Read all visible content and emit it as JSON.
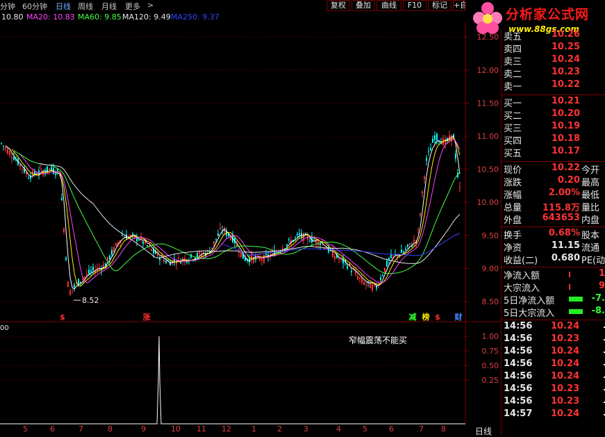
{
  "tabs": [
    {
      "label": "分钟",
      "active": false
    },
    {
      "label": "60分钟",
      "active": false
    },
    {
      "label": "日线",
      "active": true
    },
    {
      "label": "周线",
      "active": false
    },
    {
      "label": "月线",
      "active": false
    },
    {
      "label": "更多",
      "active": false
    }
  ],
  "more_arrow": ">",
  "toolbar": {
    "fuquan": "复权",
    "diejia": "叠加",
    "quxian": "曲线",
    "f10": "F10",
    "biaoji": "标记",
    "plus": "+自"
  },
  "ma_bar": [
    {
      "text": "10.80",
      "color": "#e8e8e8"
    },
    {
      "text": "MA20: 10.83",
      "color": "#ff44ff"
    },
    {
      "text": "MA60: 9.85",
      "color": "#44ff44"
    },
    {
      "text": "MA120: 9.49",
      "color": "#e8e8e8"
    },
    {
      "text": "MA250: 9.37",
      "color": "#3344ff"
    }
  ],
  "logo": {
    "title": "分析家公式网",
    "url": "www.88gs.com"
  },
  "price_axis": [
    "12.50",
    "12.00",
    "11.50",
    "11.00",
    "10.50",
    "10.00",
    "9.50",
    "9.00",
    "8.50"
  ],
  "low_label": "8.52",
  "markers": [
    {
      "text": "$",
      "color": "#ff3030"
    },
    {
      "text": "涨",
      "color": "#ff3030"
    },
    {
      "text": "减",
      "color": "#33ff33"
    },
    {
      "text": "榜",
      "color": "#ffee00"
    },
    {
      "text": "$",
      "color": "#ff3030"
    },
    {
      "text": "财",
      "color": "#4488ff"
    }
  ],
  "indicator": {
    "label_left": "00",
    "note": "窄幅震荡不能买",
    "axis": [
      "1.00",
      "0.75",
      "0.50",
      "0.25"
    ]
  },
  "x_axis": [
    "5",
    "6",
    "7",
    "8",
    "9",
    "10",
    "11",
    "12",
    "1",
    "2",
    "3",
    "4",
    "5",
    "6",
    "7",
    "8"
  ],
  "bottom_tab": "日线",
  "quote": {
    "sell": [
      {
        "label": "卖五",
        "value": "10.26"
      },
      {
        "label": "卖四",
        "value": "10.25"
      },
      {
        "label": "卖三",
        "value": "10.24"
      },
      {
        "label": "卖二",
        "value": "10.23"
      },
      {
        "label": "卖一",
        "value": "10.22"
      }
    ],
    "buy": [
      {
        "label": "买一",
        "value": "10.21"
      },
      {
        "label": "买二",
        "value": "10.20"
      },
      {
        "label": "买三",
        "value": "10.19"
      },
      {
        "label": "买四",
        "value": "10.18"
      },
      {
        "label": "买五",
        "value": "10.17"
      }
    ],
    "stats": [
      {
        "label": "现价",
        "value": "10.22",
        "label2": "今开"
      },
      {
        "label": "涨跌",
        "value": "0.20",
        "label2": "最高"
      },
      {
        "label": "涨幅",
        "value": "2.00%",
        "label2": "最低"
      },
      {
        "label": "总量",
        "value": "115.8万",
        "label2": "量比"
      },
      {
        "label": "外盘",
        "value": "643653",
        "label2": "内盘"
      }
    ],
    "stats2": [
      {
        "label": "换手",
        "value": "0.68%",
        "label2": "股本"
      },
      {
        "label": "净资",
        "value": "11.15",
        "label2": "流通"
      },
      {
        "label": "收益(二)",
        "value": "0.680",
        "label2": "PE(动"
      }
    ],
    "flow": [
      {
        "label": "净流入额",
        "value": "1"
      },
      {
        "label": "大宗流入",
        "value": "9"
      },
      {
        "label": "5日净流入额",
        "value": "-7."
      },
      {
        "label": "5日大宗流入",
        "value": "-8."
      }
    ],
    "ticks": [
      {
        "time": "14:56",
        "price": "10.24"
      },
      {
        "time": "14:56",
        "price": "10.23"
      },
      {
        "time": "14:56",
        "price": "10.24"
      },
      {
        "time": "14:56",
        "price": "10.24"
      },
      {
        "time": "14:56",
        "price": "10.24"
      },
      {
        "time": "14:56",
        "price": "10.23"
      },
      {
        "time": "14:56",
        "price": "10.23"
      },
      {
        "time": "14:57",
        "price": "10.24"
      }
    ]
  },
  "colors": {
    "up": "#ff3333",
    "down": "#00ffff",
    "ma5": "#ffffff",
    "ma10": "#ffee00",
    "ma20": "#ff44ff",
    "ma60": "#44ff44",
    "ma120": "#e8e8e8",
    "ma250": "#3344ff",
    "grid": "#7a0000"
  }
}
